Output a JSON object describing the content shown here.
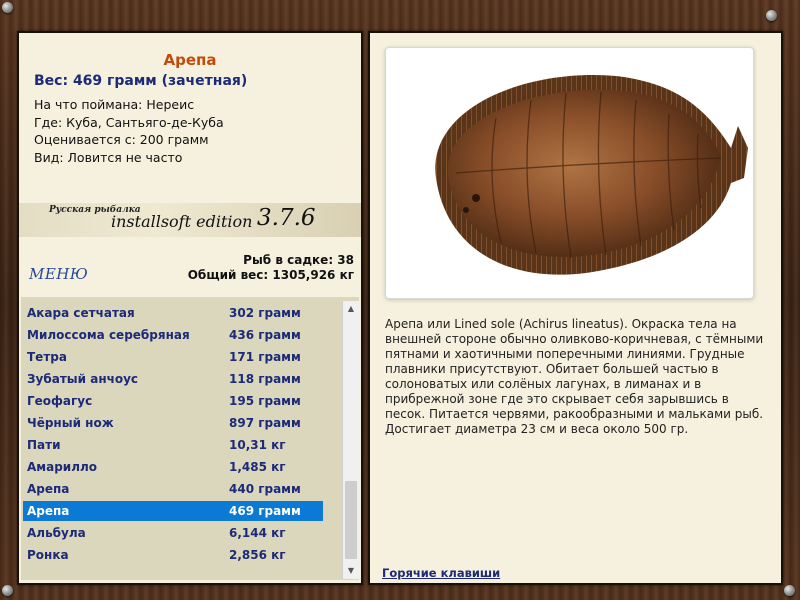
{
  "fish": {
    "name": "Арепа",
    "weight_line": "Вес: 469 грамм (зачетная)",
    "info": [
      "На что поймана: Нереис",
      "Где: Куба, Сантьяго-де-Куба",
      "Оценивается с: 200 грамм",
      "Вид: Ловится не часто"
    ],
    "description": "Арепа или Lined sole (Achirus lineatus). Окраска тела на внешней стороне обычно оливково-коричневая, с тёмными пятнами и хаотичными поперечными линиями. Грудные плавники присутствуют. Обитает большей частью в солоноватых или солёных лагунах, в лиманах и в прибрежной зоне где это скрывает себя зарывшись в песок. Питается червями, ракообразными и мальками рыб. Достигает диаметра 23 см и веса около 500 гр."
  },
  "logo": {
    "small": "Русская рыбалка",
    "main": "installsoft edition",
    "version": "3.7.6"
  },
  "menu_label": "МЕНЮ",
  "stats": {
    "fish_count": "Рыб в садке: 38",
    "total_weight": "Общий вес: 1305,926 кг"
  },
  "catch_list": [
    {
      "name": "Акара сетчатая",
      "weight": "302 грамм"
    },
    {
      "name": "Милоссома серебряная",
      "weight": "436 грамм"
    },
    {
      "name": "Тетра",
      "weight": "171 грамм"
    },
    {
      "name": "Зубатый анчоус",
      "weight": "118 грамм"
    },
    {
      "name": "Геофагус",
      "weight": "195 грамм"
    },
    {
      "name": "Чёрный нож",
      "weight": "897 грамм"
    },
    {
      "name": "Пати",
      "weight": "10,31 кг"
    },
    {
      "name": "Амарилло",
      "weight": "1,485 кг"
    },
    {
      "name": "Арепа",
      "weight": "440 грамм"
    },
    {
      "name": "Арепа",
      "weight": "469 грамм"
    },
    {
      "name": "Альбула",
      "weight": "6,144 кг"
    },
    {
      "name": "Ронка",
      "weight": "2,856 кг"
    }
  ],
  "selected_index": 9,
  "hotkeys_label": "Горячие клавиши",
  "colors": {
    "title": "#c14b0e",
    "accent_text": "#1c2a78",
    "selection": "#0a7ad4",
    "panel_bg": "#f5f1de",
    "list_bg": "#dbd7bc"
  }
}
